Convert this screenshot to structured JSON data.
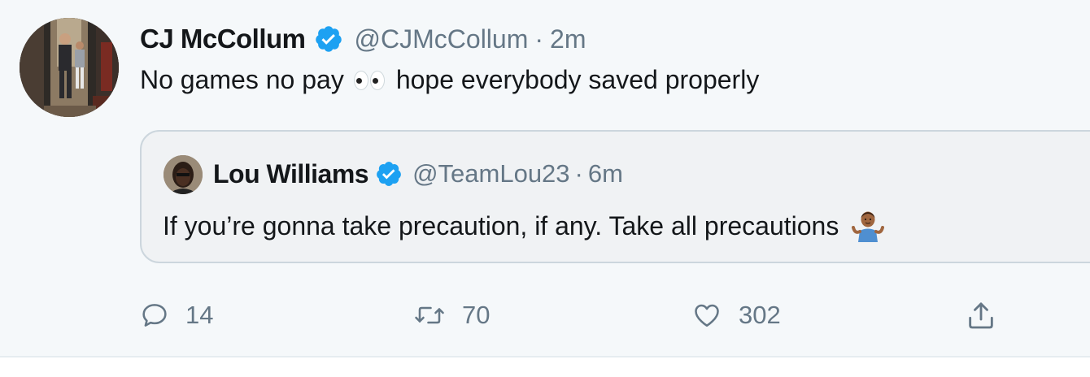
{
  "tweet": {
    "author_name": "CJ McCollum",
    "handle": "@CJMcCollum",
    "separator": "·",
    "time": "2m",
    "text_before_emoji": "No games no pay",
    "emoji": "eyes-emoji",
    "text_after_emoji": "hope everybody saved properly"
  },
  "quoted": {
    "author_name": "Lou Williams",
    "handle": "@TeamLou23",
    "separator": "·",
    "time": "6m",
    "text": "If you’re gonna take precaution, if any. Take all precautions",
    "emoji": "person-shrugging-emoji"
  },
  "actions": {
    "reply_count": "14",
    "retweet_count": "70",
    "like_count": "302"
  },
  "icons": [
    "verified-badge-icon",
    "reply-icon",
    "retweet-icon",
    "like-icon",
    "share-icon"
  ],
  "colors": {
    "verified": "#1da1f2",
    "secondary_text": "#657786",
    "border": "#ccd6dd",
    "background": "#f5f8fa"
  }
}
